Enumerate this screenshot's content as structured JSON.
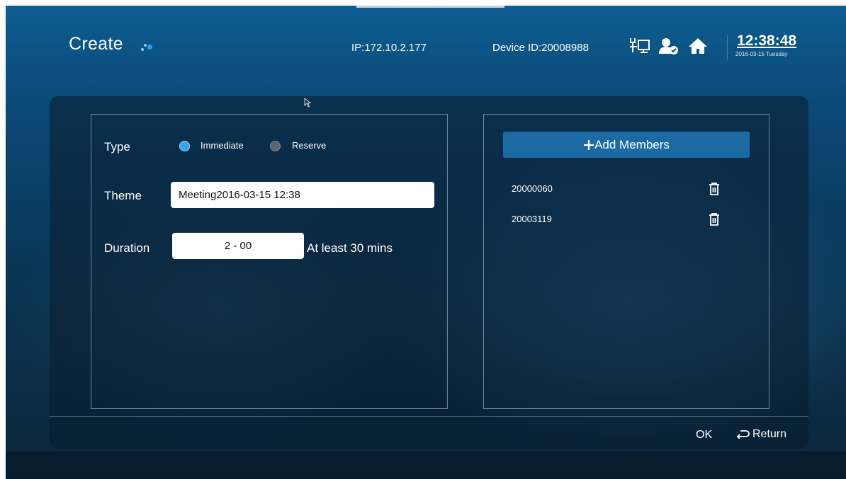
{
  "header": {
    "title": "Create",
    "ip": "IP:172.10.2.177",
    "device_id": "Device ID:20008988",
    "time": "12:38:48",
    "date": "2016-03-15 Tuesday",
    "icons": [
      "network-icon",
      "user-status-icon",
      "home-icon"
    ]
  },
  "form": {
    "type_label": "Type",
    "type_options": [
      {
        "label": "Immediate",
        "selected": true
      },
      {
        "label": "Reserve",
        "selected": false
      }
    ],
    "theme_label": "Theme",
    "theme_value": "Meeting2016-03-15 12:38",
    "duration_label": "Duration",
    "duration_value": "2 - 00",
    "duration_hint": "At least 30 mins"
  },
  "members": {
    "add_button": "Add Members",
    "add_icon": "plus-icon",
    "list": [
      {
        "id": "20000060",
        "icon": "trash-icon"
      },
      {
        "id": "20003119",
        "icon": "trash-icon"
      }
    ]
  },
  "footer": {
    "ok_label": "OK",
    "return_label": "Return",
    "return_icon": "return-arrow-icon"
  },
  "colors": {
    "accent": "#3aa3ee",
    "button": "#1c6aa3",
    "background_top": "#0d5d92",
    "background_bottom": "#0b2639"
  }
}
